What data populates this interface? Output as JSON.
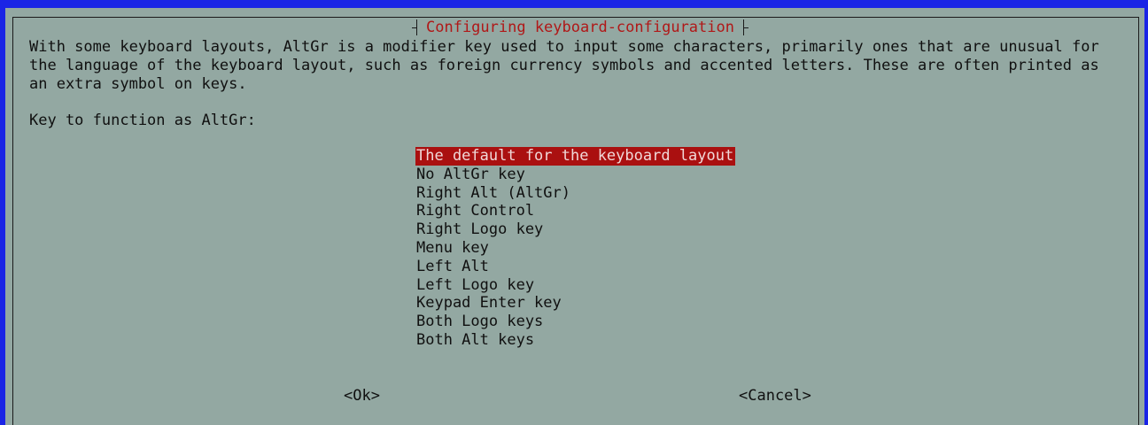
{
  "dialog": {
    "title": "Configuring keyboard-configuration",
    "description": "With some keyboard layouts, AltGr is a modifier key used to input some characters, primarily ones that are unusual for\nthe language of the keyboard layout, such as foreign currency symbols and accented letters. These are often printed as\nan extra symbol on keys.",
    "prompt": "Key to function as AltGr:",
    "options": [
      "The default for the keyboard layout",
      "No AltGr key",
      "Right Alt (AltGr)",
      "Right Control",
      "Right Logo key",
      "Menu key",
      "Left Alt",
      "Left Logo key",
      "Keypad Enter key",
      "Both Logo keys",
      "Both Alt keys"
    ],
    "selected_index": 0,
    "ok_label": "<Ok>",
    "cancel_label": "<Cancel>"
  },
  "colors": {
    "background": "#1a24e6",
    "dialog": "#93a8a2",
    "title": "#b01818",
    "selection": "#aa1010"
  }
}
